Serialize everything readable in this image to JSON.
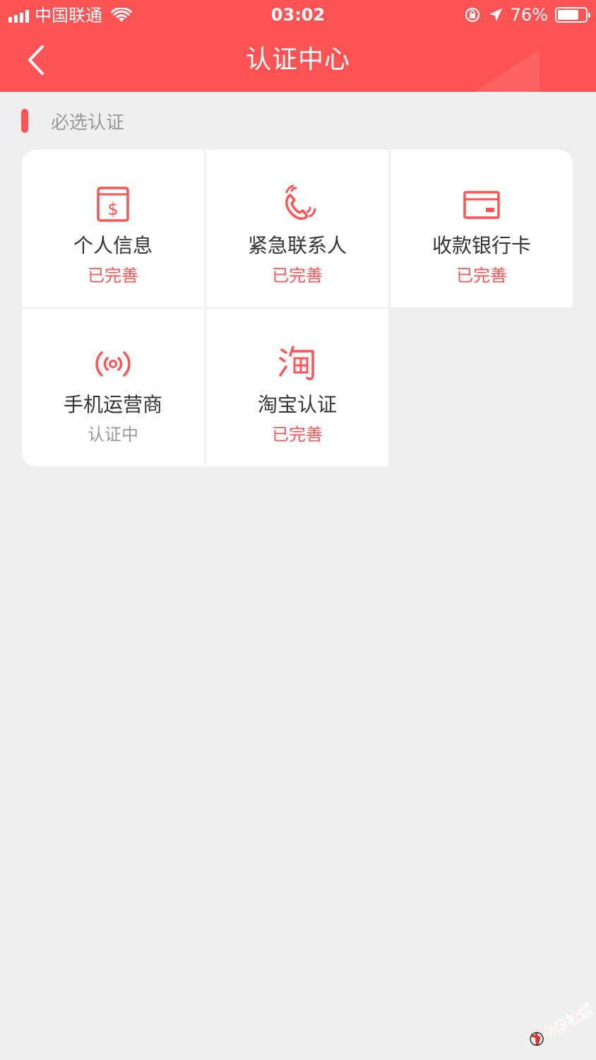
{
  "status_bar": {
    "carrier": "中国联通",
    "time": "03:02",
    "battery": "76%",
    "battery_level": 0.76
  },
  "nav": {
    "title": "认证中心"
  },
  "section": {
    "label": "必选认证"
  },
  "items": [
    {
      "name": "个人信息",
      "status": "已完善",
      "icon": "document-dollar-icon"
    },
    {
      "name": "紧急联系人",
      "status": "已完善",
      "icon": "phone-call-icon"
    },
    {
      "name": "收款银行卡",
      "status": "已完善",
      "icon": "bank-card-icon"
    },
    {
      "name": "手机运营商",
      "status": "认证中",
      "icon": "signal-broadcast-icon"
    },
    {
      "name": "淘宝认证",
      "status": "已完善",
      "icon": "taobao-icon"
    }
  ],
  "watermark": "卡农社区",
  "colors": {
    "accent": "#fc5454",
    "background": "#efeff0",
    "muted": "#999999"
  }
}
